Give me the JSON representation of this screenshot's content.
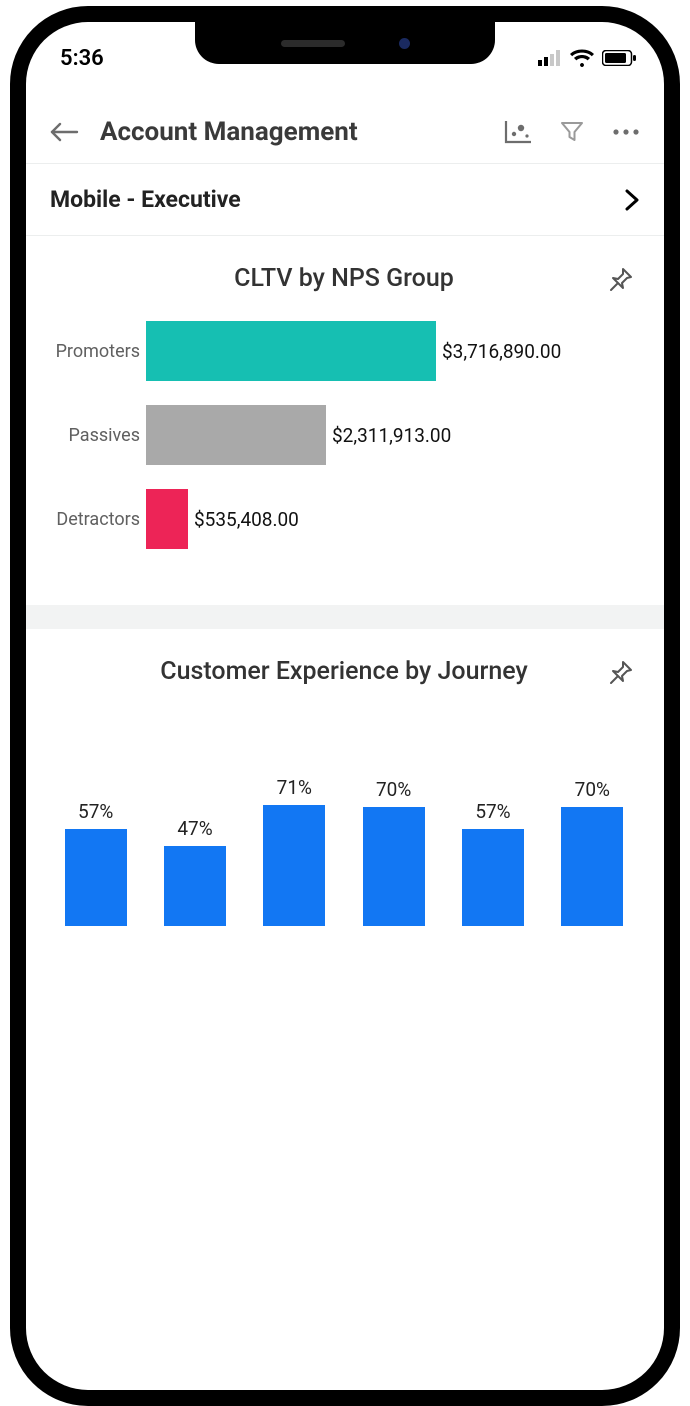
{
  "status": {
    "time": "5:36"
  },
  "nav": {
    "title": "Account Management"
  },
  "workspace": {
    "label": "Mobile - Executive"
  },
  "card1": {
    "title": "CLTV by NPS Group"
  },
  "card2": {
    "title": "Customer Experience by Journey"
  },
  "colors": {
    "promoters": "#16bfb2",
    "passives": "#a9a9a9",
    "detractors": "#ed2457",
    "column": "#1277f3"
  },
  "chart_data": [
    {
      "type": "bar",
      "orientation": "horizontal",
      "title": "CLTV by NPS Group",
      "categories": [
        "Promoters",
        "Passives",
        "Detractors"
      ],
      "values": [
        3716890.0,
        2311913.0,
        535408.0
      ],
      "value_labels": [
        "$3,716,890.00",
        "$2,311,913.00",
        "$535,408.00"
      ],
      "series_colors": [
        "#16bfb2",
        "#a9a9a9",
        "#ed2457"
      ],
      "xlabel": "",
      "ylabel": ""
    },
    {
      "type": "bar",
      "orientation": "vertical",
      "title": "Customer Experience by Journey",
      "categories": [
        "",
        "",
        "",
        "",
        "",
        ""
      ],
      "values": [
        57,
        47,
        71,
        70,
        57,
        70
      ],
      "value_labels": [
        "57%",
        "47%",
        "71%",
        "70%",
        "57%",
        "70%"
      ],
      "ylabel": "",
      "ylim": [
        0,
        100
      ],
      "series_colors": [
        "#1277f3"
      ]
    }
  ]
}
